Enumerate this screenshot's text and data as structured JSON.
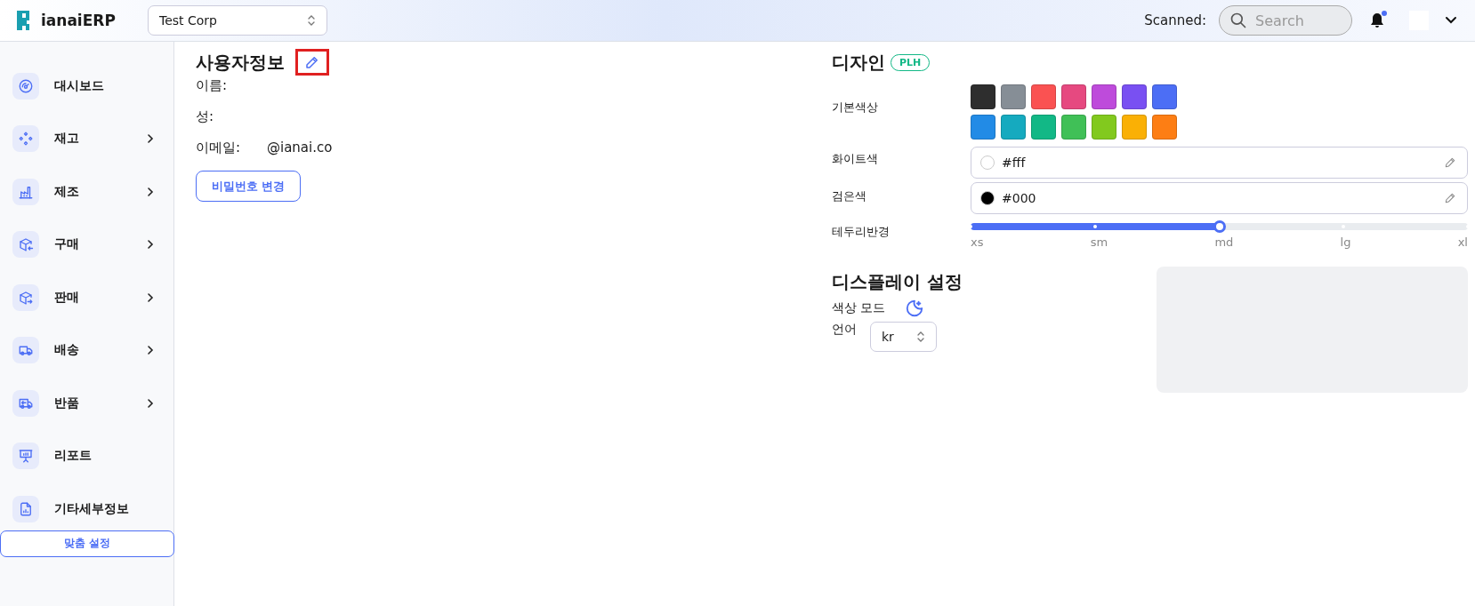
{
  "header": {
    "brand": "ianaiERP",
    "company_select": {
      "value": "Test Corp"
    },
    "scanned_label": "Scanned:",
    "search": {
      "placeholder": "Search"
    },
    "notifications": {
      "unread": true
    }
  },
  "sidebar": {
    "items": [
      {
        "label": "대시보드",
        "has_submenu": false
      },
      {
        "label": "재고",
        "has_submenu": true
      },
      {
        "label": "제조",
        "has_submenu": true
      },
      {
        "label": "구매",
        "has_submenu": true
      },
      {
        "label": "판매",
        "has_submenu": true
      },
      {
        "label": "배송",
        "has_submenu": true
      },
      {
        "label": "반품",
        "has_submenu": true
      },
      {
        "label": "리포트",
        "has_submenu": false
      },
      {
        "label": "기타세부정보",
        "has_submenu": false
      }
    ],
    "custom_button": "맞춤 설정"
  },
  "user_info": {
    "title": "사용자정보",
    "edit_highlighted": true,
    "fields": [
      {
        "label": "이름:"
      },
      {
        "label": "성:"
      },
      {
        "label": "이메일:",
        "value": "@ianai.co"
      }
    ],
    "password_button": "비밀번호 변경"
  },
  "design": {
    "title": "디자인",
    "badge": "PLH",
    "base_color_label": "기본색상",
    "swatches": [
      {
        "color": "#2e2e2e"
      },
      {
        "color": "#868e96"
      },
      {
        "color": "#fa5252"
      },
      {
        "color": "#e64980"
      },
      {
        "color": "#be4bdb"
      },
      {
        "color": "#7950f2"
      },
      {
        "color": "#4c6ef5"
      },
      {
        "color": "#228be6"
      },
      {
        "color": "#15aabf"
      },
      {
        "color": "#12b886"
      },
      {
        "color": "#40c057"
      },
      {
        "color": "#82c91e"
      },
      {
        "color": "#fab005"
      },
      {
        "color": "#fd7e14"
      }
    ],
    "white": {
      "label": "화이트색",
      "value": "#fff",
      "color": "#ffffff"
    },
    "black": {
      "label": "검은색",
      "value": "#000",
      "color": "#000000"
    },
    "radius": {
      "label": "테두리반경",
      "level": 0.5,
      "marks": [
        "xs",
        "sm",
        "md",
        "lg",
        "xl"
      ]
    }
  },
  "display": {
    "title": "디스플레이 설정",
    "color_mode_label": "색상 모드",
    "language_label": "언어",
    "language": {
      "value": "kr"
    }
  }
}
